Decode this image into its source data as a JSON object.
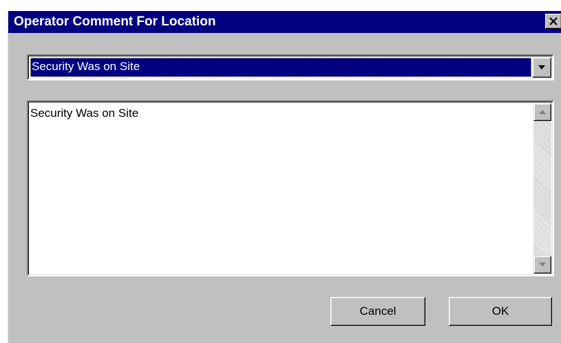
{
  "window": {
    "title": "Operator Comment For Location",
    "close_icon": "close-icon"
  },
  "comment_select": {
    "selected_value": "Security Was on Site",
    "dropdown_icon": "chevron-down-icon"
  },
  "comment_text": {
    "value": "Security Was on Site"
  },
  "scrollbar": {
    "up_icon": "scroll-up-icon",
    "down_icon": "scroll-down-icon"
  },
  "buttons": {
    "cancel_label": "Cancel",
    "ok_label": "OK"
  },
  "colors": {
    "title_bar": "#000080",
    "dialog_face": "#c0c0c0",
    "selection_highlight": "#000080"
  }
}
